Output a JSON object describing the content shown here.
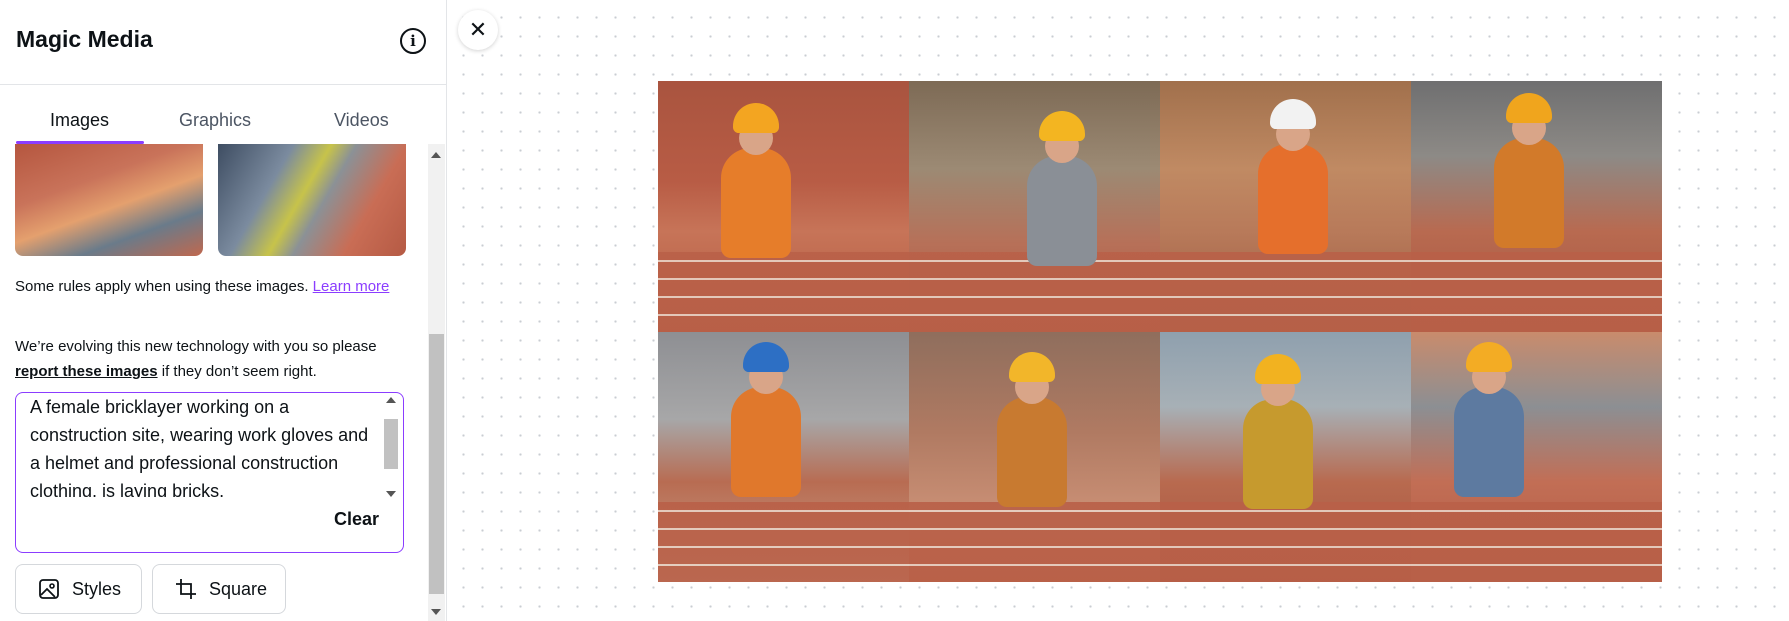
{
  "panel": {
    "title": "Magic Media",
    "tabs": [
      {
        "label": "Images",
        "active": true
      },
      {
        "label": "Graphics",
        "active": false
      },
      {
        "label": "Videos",
        "active": false
      }
    ],
    "rules_text": "Some rules apply when using these images.",
    "rules_link": "Learn more",
    "evolve_prefix": "We’re evolving this new technology with you so please",
    "evolve_link": "report these images",
    "evolve_suffix": "if they don’t seem right.",
    "prompt": "A female bricklayer working on a construction site, wearing work gloves and a helmet and professional construction clothing, is laying bricks.",
    "clear_label": "Clear",
    "styles_label": "Styles",
    "square_label": "Square"
  },
  "results": [
    {
      "name": "result-image-1",
      "helmet": "#f3a521",
      "shirt": "#e67d2a"
    },
    {
      "name": "result-image-2",
      "helmet": "#f3b521",
      "shirt": "#8a8f96"
    },
    {
      "name": "result-image-3",
      "helmet": "#f2f2f2",
      "shirt": "#e56f2c"
    },
    {
      "name": "result-image-4",
      "helmet": "#f0a51d",
      "shirt": "#d27a2a"
    },
    {
      "name": "result-image-5",
      "helmet": "#2d6fc4",
      "shirt": "#e0782c"
    },
    {
      "name": "result-image-6",
      "helmet": "#f2b62a",
      "shirt": "#c87a30"
    },
    {
      "name": "result-image-7",
      "helmet": "#f2b220",
      "shirt": "#c69a2e"
    },
    {
      "name": "result-image-8",
      "helmet": "#f3ac24",
      "shirt": "#5d7aa0"
    }
  ],
  "colors": {
    "accent": "#8b3dff",
    "brick": "#b96048"
  }
}
